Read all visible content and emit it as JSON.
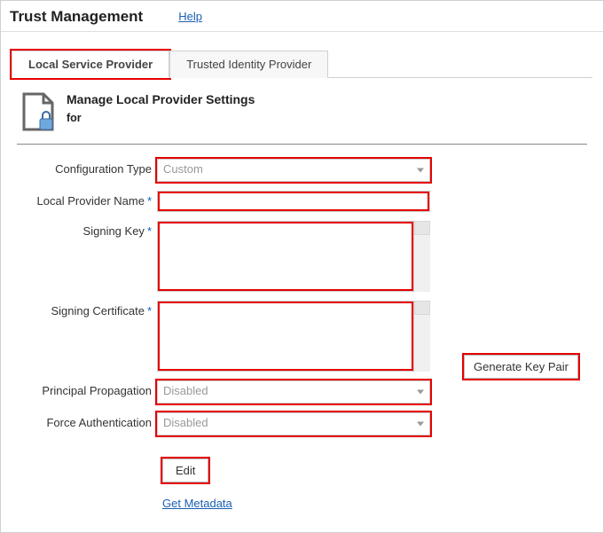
{
  "header": {
    "title": "Trust Management",
    "help": "Help"
  },
  "tabs": {
    "local": "Local Service Provider",
    "trusted": "Trusted Identity Provider"
  },
  "section": {
    "title": "Manage Local Provider Settings",
    "sub": "for"
  },
  "form": {
    "config_type": {
      "label": "Configuration Type",
      "value": "Custom"
    },
    "local_provider_name": {
      "label": "Local Provider Name",
      "value": ""
    },
    "signing_key": {
      "label": "Signing Key",
      "value": ""
    },
    "signing_certificate": {
      "label": "Signing Certificate",
      "value": ""
    },
    "principal_propagation": {
      "label": "Principal Propagation",
      "value": "Disabled"
    },
    "force_authentication": {
      "label": "Force Authentication",
      "value": "Disabled"
    }
  },
  "buttons": {
    "generate_key_pair": "Generate Key Pair",
    "edit": "Edit",
    "get_metadata": "Get Metadata"
  }
}
